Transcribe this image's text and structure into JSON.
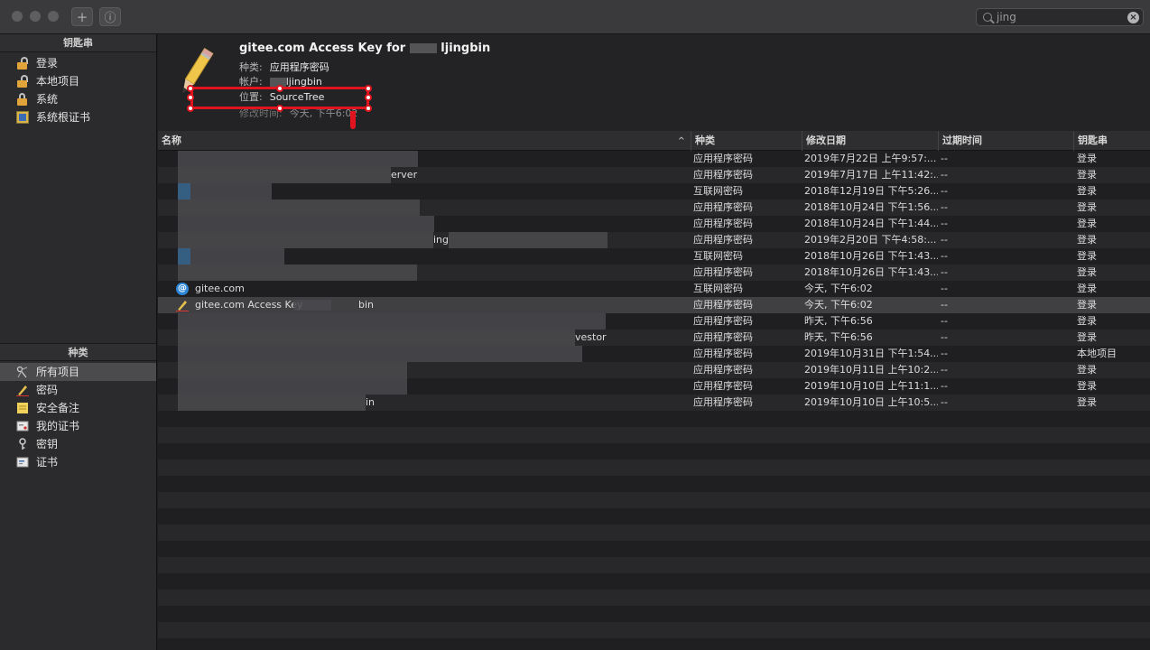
{
  "search": {
    "value": "jing"
  },
  "toolbar": {
    "add_label": "+",
    "info_label": "ⓘ"
  },
  "sidebar": {
    "keychains_header": "钥匙串",
    "keychains": [
      {
        "label": "登录",
        "icon": "lock-open-icon"
      },
      {
        "label": "本地项目",
        "icon": "lock-open-icon"
      },
      {
        "label": "系统",
        "icon": "lock-icon"
      },
      {
        "label": "系统根证书",
        "icon": "cert-root-icon"
      }
    ],
    "category_header": "种类",
    "categories": [
      {
        "label": "所有项目",
        "icon": "all-items-icon",
        "selected": true
      },
      {
        "label": "密码",
        "icon": "password-icon"
      },
      {
        "label": "安全备注",
        "icon": "secure-note-icon"
      },
      {
        "label": "我的证书",
        "icon": "my-cert-icon"
      },
      {
        "label": "密钥",
        "icon": "key-icon"
      },
      {
        "label": "证书",
        "icon": "cert-icon"
      }
    ]
  },
  "detail": {
    "title": "gitee.com Access Key for",
    "title_suffix": "ljingbin",
    "kind_label": "种类:",
    "kind_value": "应用程序密码",
    "account_label": "帐户:",
    "account_value": "ljingbin",
    "where_label": "位置:",
    "where_value": "SourceTree",
    "modified_label": "修改时间:",
    "modified_value": "今天, 下午6:02"
  },
  "table": {
    "columns": [
      "名称",
      "种类",
      "修改日期",
      "过期时间",
      "钥匙串"
    ],
    "rows": [
      {
        "name": "",
        "kind": "应用程序密码",
        "date": "2019年7月22日 上午9:57:...",
        "expires": "--",
        "keychain": "登录"
      },
      {
        "name": "erver",
        "kind": "应用程序密码",
        "date": "2019年7月17日 上午11:42:...",
        "expires": "--",
        "keychain": "登录"
      },
      {
        "name": "",
        "kind": "互联网密码",
        "date": "2018年12月19日 下午5:26...",
        "expires": "--",
        "keychain": "登录"
      },
      {
        "name": "",
        "kind": "应用程序密码",
        "date": "2018年10月24日 下午1:56...",
        "expires": "--",
        "keychain": "登录"
      },
      {
        "name": "",
        "kind": "应用程序密码",
        "date": "2018年10月24日 下午1:44...",
        "expires": "--",
        "keychain": "登录"
      },
      {
        "name": "ing",
        "kind": "应用程序密码",
        "date": "2019年2月20日 下午4:58:...",
        "expires": "--",
        "keychain": "登录"
      },
      {
        "name": "",
        "kind": "互联网密码",
        "date": "2018年10月26日 下午1:43...",
        "expires": "--",
        "keychain": "登录"
      },
      {
        "name": "",
        "kind": "应用程序密码",
        "date": "2018年10月26日 下午1:43...",
        "expires": "--",
        "keychain": "登录"
      },
      {
        "name": "gitee.com",
        "kind": "互联网密码",
        "date": "今天, 下午6:02",
        "expires": "--",
        "keychain": "登录"
      },
      {
        "name": "gitee.com Access Key for",
        "name_suffix": "bin",
        "kind": "应用程序密码",
        "date": "今天, 下午6:02",
        "expires": "--",
        "keychain": "登录"
      },
      {
        "name": "",
        "kind": "应用程序密码",
        "date": "昨天, 下午6:56",
        "expires": "--",
        "keychain": "登录"
      },
      {
        "name": "vestor",
        "kind": "应用程序密码",
        "date": "昨天, 下午6:56",
        "expires": "--",
        "keychain": "登录"
      },
      {
        "name": "",
        "kind": "应用程序密码",
        "date": "2019年10月31日 下午1:54...",
        "expires": "--",
        "keychain": "本地项目"
      },
      {
        "name": "",
        "kind": "应用程序密码",
        "date": "2019年10月11日 上午10:2...",
        "expires": "--",
        "keychain": "登录"
      },
      {
        "name": "",
        "kind": "应用程序密码",
        "date": "2019年10月10日 上午11:1...",
        "expires": "--",
        "keychain": "登录"
      },
      {
        "name": "in",
        "kind": "应用程序密码",
        "date": "2019年10月10日 上午10:5...",
        "expires": "--",
        "keychain": "登录"
      }
    ]
  },
  "colors": {
    "annotation": "#e0141e",
    "at_icon": "#2d86d8",
    "lock": "#e0a43a"
  }
}
